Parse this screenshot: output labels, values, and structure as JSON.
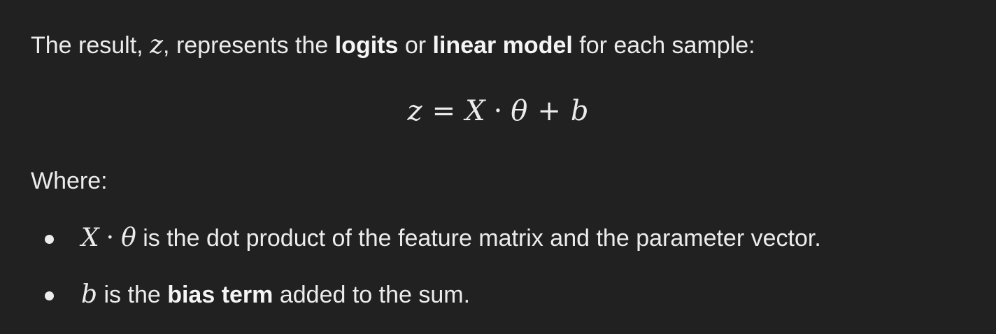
{
  "intro": {
    "text_before": "The result, ",
    "var_z": "z",
    "text_mid1": ", represents the ",
    "bold1": "logits",
    "text_mid2": " or ",
    "bold2": "linear model",
    "text_after": " for each sample:"
  },
  "equation": {
    "lhs": "z",
    "equals": "=",
    "x": "X",
    "dot": "·",
    "theta": "θ",
    "plus": "+",
    "b": "b"
  },
  "where_label": "Where:",
  "list": [
    {
      "math_x": "X",
      "math_dot": "·",
      "math_theta": "θ",
      "text": " is the dot product of the feature matrix and the parameter vector."
    },
    {
      "math_b": "b",
      "text_before": " is the ",
      "bold": "bias term",
      "text_after": " added to the sum."
    }
  ]
}
